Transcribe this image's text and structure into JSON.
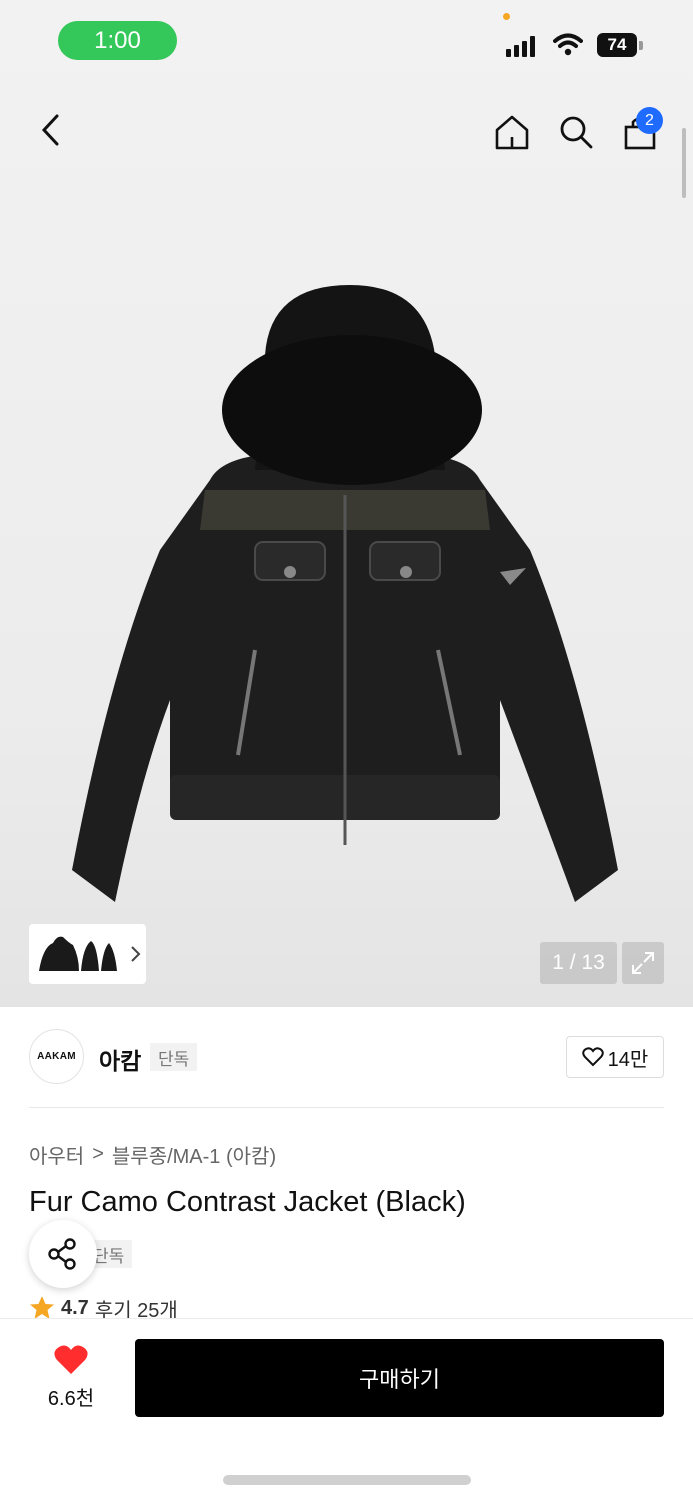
{
  "status_bar": {
    "time": "1:00",
    "battery": "74"
  },
  "gallery": {
    "counter": "1 / 13"
  },
  "nav": {
    "cart_count": "2"
  },
  "brand": {
    "logo_text": "AAKAM",
    "name": "아캄",
    "exclusive_label": "단독",
    "likes": "14만"
  },
  "breadcrumb": {
    "category": "아우터",
    "separator": ">",
    "subcategory": "블루종/MA-1 (아캄)"
  },
  "product": {
    "title": "Fur Camo Contrast Jacket (Black)",
    "exclusive_label": "단독",
    "rating": "4.7",
    "review_label": "후기 25개"
  },
  "bottom": {
    "wish_count": "6.6천",
    "buy_label": "구매하기"
  },
  "colors": {
    "status_green": "#34c759",
    "badge_blue": "#1f6bff",
    "heart_red": "#ff2d2d",
    "buy_bg": "#000000",
    "star": "#f5a623"
  }
}
